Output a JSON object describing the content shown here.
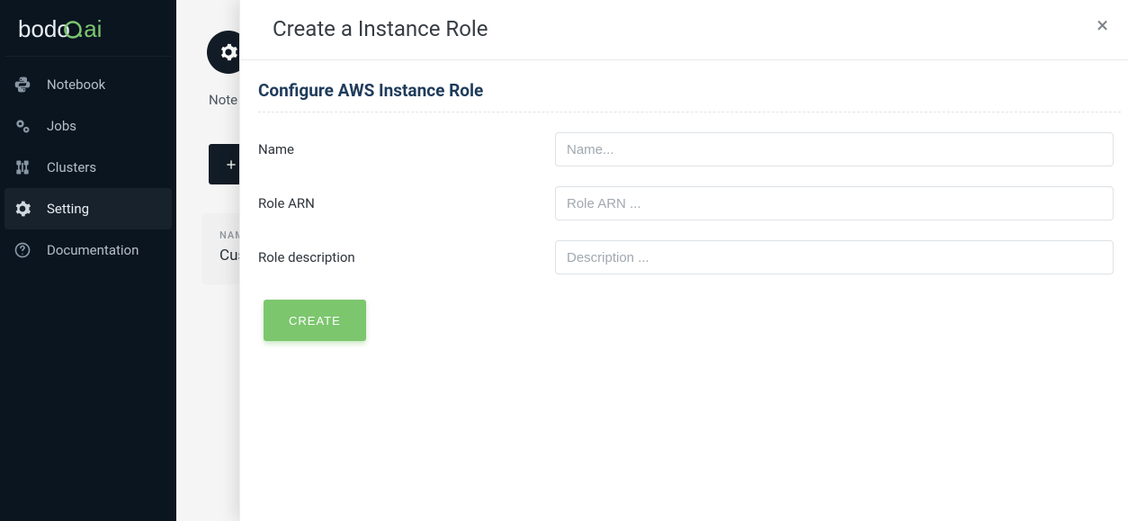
{
  "logo": {
    "text_main": "bodo",
    "text_suffix": ".ai"
  },
  "sidebar": {
    "items": [
      {
        "label": "Notebook",
        "icon": "python-icon"
      },
      {
        "label": "Jobs",
        "icon": "gears-icon"
      },
      {
        "label": "Clusters",
        "icon": "nodes-icon"
      },
      {
        "label": "Setting",
        "icon": "gear-icon",
        "active": true
      },
      {
        "label": "Documentation",
        "icon": "help-icon"
      }
    ]
  },
  "page": {
    "breadcrumb_partial": "Note",
    "card_label_partial": "NAM",
    "card_value_partial": "Cus"
  },
  "modal": {
    "title": "Create a Instance Role",
    "section_title": "Configure AWS Instance Role",
    "fields": {
      "name": {
        "label": "Name",
        "placeholder": "Name..."
      },
      "arn": {
        "label": "Role ARN",
        "placeholder": "Role ARN ..."
      },
      "desc": {
        "label": "Role description",
        "placeholder": "Description ..."
      }
    },
    "create_label": "CREATE"
  }
}
